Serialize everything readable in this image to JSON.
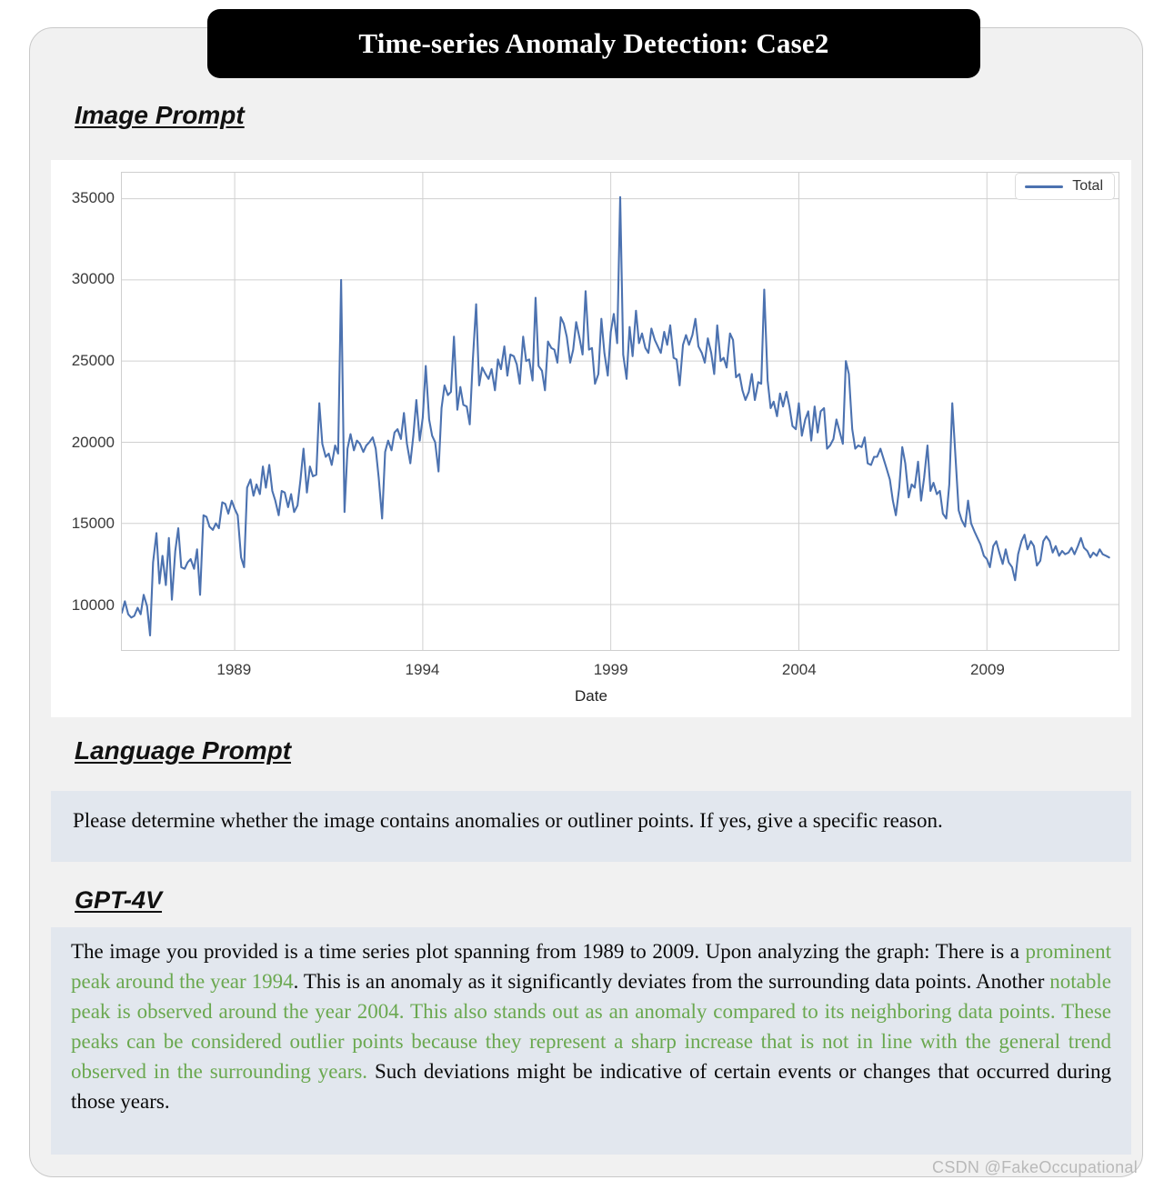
{
  "title": "Time-series Anomaly Detection: Case2",
  "sections": {
    "image_prompt_heading": "Image Prompt",
    "language_prompt_heading": "Language Prompt",
    "model_heading": "GPT-4V"
  },
  "language_prompt": "Please determine whether the image contains anomalies or outliner points. If yes, give a specific reason.",
  "gpt_response": {
    "part1": "The image you provided is a time series plot spanning from 1989 to 2009. Upon analyzing the graph: There is a ",
    "green1": "prominent peak around the year 1994",
    "part2": ". This is an anomaly as it significantly deviates from the surrounding data points. Another ",
    "green2": "notable peak is observed around the year 2004. This also stands out as an anomaly compared to its neighboring data points. These peaks can be considered outlier points because they represent a sharp increase that is not in line with the general trend observed in the surrounding years.",
    "part3": " Such deviations might be indicative of certain events or changes that occurred during those years."
  },
  "watermark": "CSDN @FakeOccupational",
  "colors": {
    "line": "#4c72b0",
    "highlight_green": "#6aa84f",
    "title_bg": "#000000",
    "card_bg": "#f1f1f1",
    "textbox_bg": "#e2e7ee"
  },
  "chart_data": {
    "type": "line",
    "title": "",
    "xlabel": "Date",
    "ylabel": "",
    "legend": [
      "Total"
    ],
    "legend_position": "upper right",
    "grid": true,
    "xlim": [
      1986.0,
      2012.5
    ],
    "ylim": [
      7200,
      36600
    ],
    "xticks": [
      1989,
      1994,
      1999,
      2004,
      2009
    ],
    "yticks": [
      10000,
      15000,
      20000,
      25000,
      30000,
      35000
    ],
    "series": [
      {
        "name": "Total",
        "x": [
          1986.0,
          1986.08,
          1986.17,
          1986.25,
          1986.33,
          1986.42,
          1986.5,
          1986.58,
          1986.67,
          1986.75,
          1986.83,
          1986.92,
          1987.0,
          1987.08,
          1987.17,
          1987.25,
          1987.33,
          1987.42,
          1987.5,
          1987.58,
          1987.67,
          1987.75,
          1987.83,
          1987.92,
          1988.0,
          1988.08,
          1988.17,
          1988.25,
          1988.33,
          1988.42,
          1988.5,
          1988.58,
          1988.67,
          1988.75,
          1988.83,
          1988.92,
          1989.0,
          1989.08,
          1989.17,
          1989.25,
          1989.33,
          1989.42,
          1989.5,
          1989.58,
          1989.67,
          1989.75,
          1989.83,
          1989.92,
          1990.0,
          1990.08,
          1990.17,
          1990.25,
          1990.33,
          1990.42,
          1990.5,
          1990.58,
          1990.67,
          1990.75,
          1990.83,
          1990.92,
          1991.0,
          1991.08,
          1991.17,
          1991.25,
          1991.33,
          1991.42,
          1991.5,
          1991.58,
          1991.67,
          1991.75,
          1991.83,
          1991.92,
          1992.0,
          1992.08,
          1992.17,
          1992.25,
          1992.33,
          1992.42,
          1992.5,
          1992.58,
          1992.67,
          1992.75,
          1992.83,
          1992.92,
          1993.0,
          1993.08,
          1993.17,
          1993.25,
          1993.33,
          1993.42,
          1993.5,
          1993.58,
          1993.67,
          1993.75,
          1993.83,
          1993.92,
          1994.0,
          1994.08,
          1994.17,
          1994.25,
          1994.33,
          1994.42,
          1994.5,
          1994.58,
          1994.67,
          1994.75,
          1994.83,
          1994.92,
          1995.0,
          1995.08,
          1995.17,
          1995.25,
          1995.33,
          1995.42,
          1995.5,
          1995.58,
          1995.67,
          1995.75,
          1995.83,
          1995.92,
          1996.0,
          1996.08,
          1996.17,
          1996.25,
          1996.33,
          1996.42,
          1996.5,
          1996.58,
          1996.67,
          1996.75,
          1996.83,
          1996.92,
          1997.0,
          1997.08,
          1997.17,
          1997.25,
          1997.33,
          1997.42,
          1997.5,
          1997.58,
          1997.67,
          1997.75,
          1997.83,
          1997.92,
          1998.0,
          1998.08,
          1998.17,
          1998.25,
          1998.33,
          1998.42,
          1998.5,
          1998.58,
          1998.67,
          1998.75,
          1998.83,
          1998.92,
          1999.0,
          1999.08,
          1999.17,
          1999.25,
          1999.33,
          1999.42,
          1999.5,
          1999.58,
          1999.67,
          1999.75,
          1999.83,
          1999.92,
          2000.0,
          2000.08,
          2000.17,
          2000.25,
          2000.33,
          2000.42,
          2000.5,
          2000.58,
          2000.67,
          2000.75,
          2000.83,
          2000.92,
          2001.0,
          2001.08,
          2001.17,
          2001.25,
          2001.33,
          2001.42,
          2001.5,
          2001.58,
          2001.67,
          2001.75,
          2001.83,
          2001.92,
          2002.0,
          2002.08,
          2002.17,
          2002.25,
          2002.33,
          2002.42,
          2002.5,
          2002.58,
          2002.67,
          2002.75,
          2002.83,
          2002.92,
          2003.0,
          2003.08,
          2003.17,
          2003.25,
          2003.33,
          2003.42,
          2003.5,
          2003.58,
          2003.67,
          2003.75,
          2003.83,
          2003.92,
          2004.0,
          2004.08,
          2004.17,
          2004.25,
          2004.33,
          2004.42,
          2004.5,
          2004.58,
          2004.67,
          2004.75,
          2004.83,
          2004.92,
          2005.0,
          2005.08,
          2005.17,
          2005.25,
          2005.33,
          2005.42,
          2005.5,
          2005.58,
          2005.67,
          2005.75,
          2005.83,
          2005.92,
          2006.0,
          2006.08,
          2006.17,
          2006.25,
          2006.33,
          2006.42,
          2006.5,
          2006.58,
          2006.67,
          2006.75,
          2006.83,
          2006.92,
          2007.0,
          2007.08,
          2007.17,
          2007.25,
          2007.33,
          2007.42,
          2007.5,
          2007.58,
          2007.67,
          2007.75,
          2007.83,
          2007.92,
          2008.0,
          2008.08,
          2008.17,
          2008.25,
          2008.33,
          2008.42,
          2008.5,
          2008.58,
          2008.67,
          2008.75,
          2008.83,
          2008.92,
          2009.0,
          2009.08,
          2009.17,
          2009.25,
          2009.33,
          2009.42,
          2009.5,
          2009.58,
          2009.67,
          2009.75,
          2009.83,
          2009.92,
          2010.0,
          2010.08,
          2010.17,
          2010.25,
          2010.33,
          2010.42,
          2010.5,
          2010.58,
          2010.67,
          2010.75,
          2010.83,
          2010.92,
          2011.0,
          2011.08,
          2011.17,
          2011.25,
          2011.33,
          2011.42,
          2011.5,
          2011.58,
          2011.67,
          2011.75,
          2011.83,
          2011.92,
          2012.0,
          2012.08,
          2012.17,
          2012.25
        ],
        "values": [
          9500,
          10200,
          9400,
          9200,
          9300,
          9800,
          9400,
          10600,
          9900,
          8100,
          12600,
          14400,
          11300,
          13000,
          11200,
          14100,
          10300,
          13300,
          14700,
          12300,
          12200,
          12600,
          12800,
          12200,
          13400,
          10600,
          15500,
          15400,
          14800,
          14600,
          15000,
          14700,
          16300,
          16200,
          15600,
          16400,
          15900,
          15500,
          12900,
          12300,
          17200,
          17700,
          16700,
          17400,
          16800,
          18500,
          17200,
          18600,
          17000,
          16400,
          15500,
          17000,
          16900,
          16000,
          16800,
          15700,
          16100,
          17700,
          19600,
          16900,
          18500,
          17900,
          18000,
          22400,
          19900,
          19100,
          19300,
          18600,
          19800,
          19300,
          30000,
          15700,
          19600,
          20500,
          19500,
          20100,
          19900,
          19400,
          19800,
          20000,
          20300,
          19600,
          17800,
          15300,
          19400,
          20100,
          19500,
          20600,
          20800,
          20200,
          21800,
          19900,
          18700,
          20400,
          22600,
          20100,
          21500,
          24700,
          21400,
          20400,
          20000,
          18200,
          22100,
          23500,
          22900,
          23100,
          26500,
          22000,
          23400,
          22300,
          22200,
          21100,
          25000,
          28500,
          23500,
          24600,
          24200,
          23900,
          24500,
          23200,
          25100,
          24500,
          25900,
          24100,
          25400,
          25300,
          24800,
          23600,
          26500,
          25000,
          25100,
          23800,
          28900,
          24700,
          24400,
          23200,
          26200,
          25800,
          25700,
          24900,
          27700,
          27300,
          26500,
          24900,
          25700,
          27400,
          26400,
          25400,
          29300,
          25700,
          25800,
          23600,
          24200,
          27600,
          25500,
          24100,
          26800,
          27900,
          26100,
          35100,
          25400,
          23900,
          27100,
          25300,
          28100,
          26100,
          26700,
          25800,
          25500,
          27000,
          26300,
          25900,
          25500,
          26800,
          26000,
          27200,
          25200,
          25100,
          23500,
          26000,
          26600,
          26000,
          26600,
          27600,
          25900,
          25500,
          24900,
          26400,
          25500,
          24200,
          27200,
          25000,
          25200,
          24600,
          26700,
          26300,
          24000,
          24200,
          23200,
          22600,
          23100,
          24200,
          22600,
          23700,
          23600,
          29400,
          23800,
          22100,
          22500,
          21600,
          23000,
          22200,
          23100,
          22200,
          21000,
          20800,
          22400,
          20400,
          21400,
          21900,
          20100,
          22200,
          20600,
          21900,
          22100,
          19600,
          19800,
          20200,
          21400,
          20700,
          19900,
          25000,
          24200,
          20800,
          19600,
          19800,
          19700,
          20300,
          18700,
          18600,
          19100,
          19100,
          19600,
          19000,
          18400,
          17700,
          16400,
          15500,
          17200,
          19700,
          18700,
          16600,
          17400,
          17200,
          18800,
          16400,
          17800,
          19800,
          17000,
          17500,
          16800,
          17000,
          15600,
          15300,
          17400,
          22400,
          18900,
          15800,
          15200,
          14800,
          16400,
          15000,
          14500,
          14100,
          13700,
          13000,
          12800,
          12300,
          13600,
          13900,
          13200,
          12500,
          13400,
          12600,
          12300,
          11500,
          13100,
          13900,
          14300,
          13400,
          13900,
          13600,
          12400,
          12700,
          13900,
          14200,
          13900,
          13200,
          13600,
          13000,
          13300,
          13100,
          13200,
          13500,
          13100,
          13600,
          14100,
          13500,
          13300,
          12900,
          13200,
          13000,
          13400,
          13100,
          13000,
          12900
        ]
      }
    ]
  }
}
